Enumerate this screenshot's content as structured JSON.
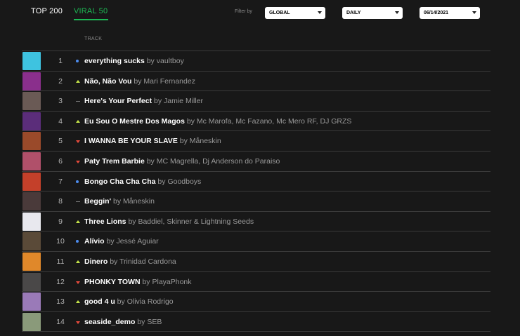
{
  "tabs": {
    "top200": "TOP 200",
    "viral50": "VIRAL 50"
  },
  "filter": {
    "label": "Filter by",
    "region": "GLOBAL",
    "interval": "DAILY",
    "date": "06/14/2021"
  },
  "columns": {
    "track": "TRACK"
  },
  "by_word": "by",
  "rows": [
    {
      "position": "1",
      "trend": "new",
      "title": "everything sucks",
      "artist": "vaultboy",
      "art_color": "#3ec3e0"
    },
    {
      "position": "2",
      "trend": "up",
      "title": "Não, Não Vou",
      "artist": "Mari Fernandez",
      "art_color": "#8a2f8c"
    },
    {
      "position": "3",
      "trend": "same",
      "title": "Here's Your Perfect",
      "artist": "Jamie Miller",
      "art_color": "#6a5a55"
    },
    {
      "position": "4",
      "trend": "up",
      "title": "Eu Sou O Mestre Dos Magos",
      "artist": "Mc Marofa, Mc Fazano, Mc Mero RF, DJ GRZS",
      "art_color": "#5b2d7a"
    },
    {
      "position": "5",
      "trend": "down",
      "title": "I WANNA BE YOUR SLAVE",
      "artist": "Måneskin",
      "art_color": "#9a4a2a"
    },
    {
      "position": "6",
      "trend": "down",
      "title": "Paty Trem Barbie",
      "artist": "MC Magrella, Dj Anderson do Paraiso",
      "art_color": "#b0506a"
    },
    {
      "position": "7",
      "trend": "new",
      "title": "Bongo Cha Cha Cha",
      "artist": "Goodboys",
      "art_color": "#c4402a"
    },
    {
      "position": "8",
      "trend": "same",
      "title": "Beggin'",
      "artist": "Måneskin",
      "art_color": "#4a3a3a"
    },
    {
      "position": "9",
      "trend": "up",
      "title": "Three Lions",
      "artist": "Baddiel, Skinner & Lightning Seeds",
      "art_color": "#e8e8ee"
    },
    {
      "position": "10",
      "trend": "new",
      "title": "Alívio",
      "artist": "Jessé Aguiar",
      "art_color": "#5a4a38"
    },
    {
      "position": "11",
      "trend": "up",
      "title": "Dinero",
      "artist": "Trinidad Cardona",
      "art_color": "#e0882a"
    },
    {
      "position": "12",
      "trend": "down",
      "title": "PHONKY TOWN",
      "artist": "PlayaPhonk",
      "art_color": "#4a4848"
    },
    {
      "position": "13",
      "trend": "up",
      "title": "good 4 u",
      "artist": "Olivia Rodrigo",
      "art_color": "#9a7ab8"
    },
    {
      "position": "14",
      "trend": "down",
      "title": "seaside_demo",
      "artist": "SEB",
      "art_color": "#8a9a7a"
    }
  ]
}
